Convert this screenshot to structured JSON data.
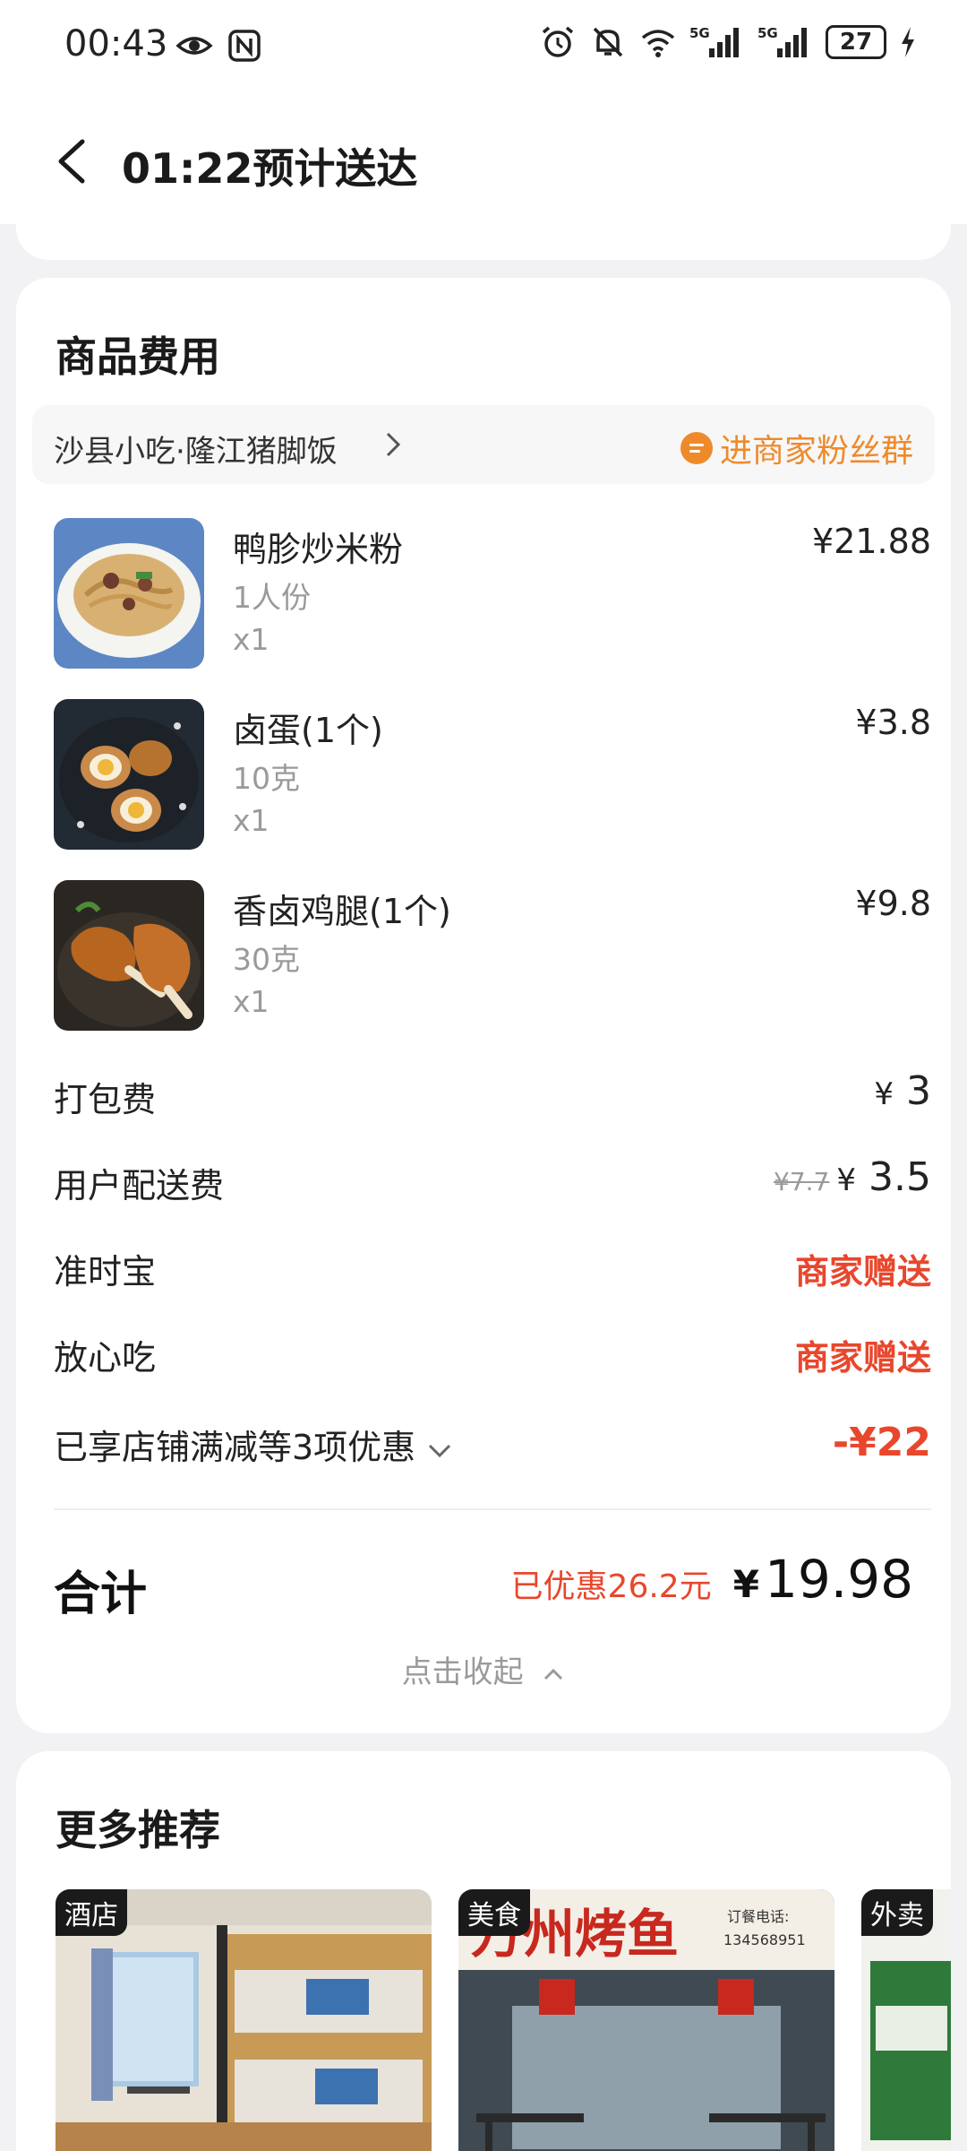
{
  "status_bar": {
    "time": "00:43",
    "left_icons": [
      "eye-icon",
      "nfc-icon"
    ],
    "right_icons": [
      "alarm-icon",
      "bell-off-icon",
      "wifi-icon",
      "signal-5g-icon",
      "signal-5g-icon"
    ],
    "signal_label": "5G",
    "battery": "27"
  },
  "nav": {
    "title": "01:22预计送达"
  },
  "order": {
    "section_title": "商品费用",
    "store_name": "沙县小吃·隆江猪脚饭",
    "fan_group_label": "进商家粉丝群",
    "items": [
      {
        "name": "鸭胗炒米粉",
        "spec": "1人份",
        "qty": "x1",
        "price": "¥21.88"
      },
      {
        "name": "卤蛋(1个)",
        "spec": "10克",
        "qty": "x1",
        "price": "¥3.8"
      },
      {
        "name": "香卤鸡腿(1个)",
        "spec": "30克",
        "qty": "x1",
        "price": "¥9.8"
      }
    ],
    "fees": {
      "packing_label": "打包费",
      "packing_yen": "¥",
      "packing_value": "3",
      "delivery_label": "用户配送费",
      "delivery_original": "¥7.7",
      "delivery_yen": "¥",
      "delivery_value": "3.5",
      "ontime_label": "准时宝",
      "ontime_value": "商家赠送",
      "safe_label": "放心吃",
      "safe_value": "商家赠送",
      "discount_label": "已享店铺满减等3项优惠",
      "discount_value": "-¥22"
    },
    "total_label": "合计",
    "saved_text": "已优惠26.2元",
    "total_yen": "¥",
    "total_value": "19.98",
    "collapse_label": "点击收起"
  },
  "recommend": {
    "title": "更多推荐",
    "cards": [
      {
        "tag": "酒店"
      },
      {
        "tag": "美食",
        "sign_text": "万州烤鱼",
        "phone_label": "订餐电话:",
        "phone": "134568951"
      },
      {
        "tag": "外卖"
      }
    ]
  },
  "colors": {
    "accent_orange": "#ef8a2a",
    "discount_red": "#e8472d",
    "background": "#f2f2f4"
  }
}
